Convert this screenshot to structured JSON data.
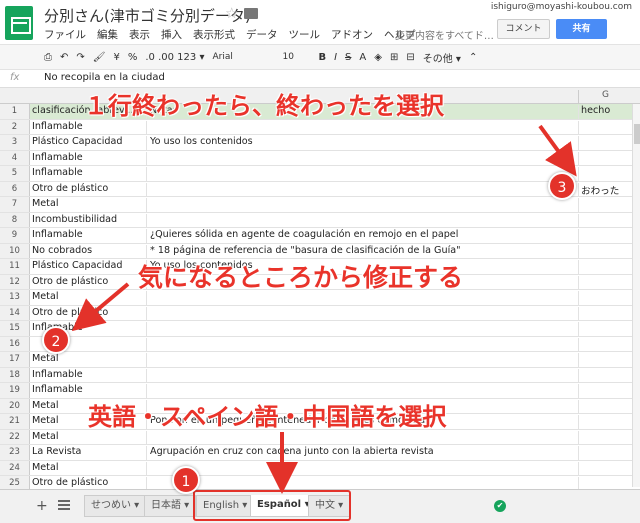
{
  "app": {
    "doc_title": "分別さん(津市ゴミ分別データ)",
    "menus": [
      "ファイル",
      "編集",
      "表示",
      "挿入",
      "表示形式",
      "データ",
      "ツール",
      "アドオン",
      "ヘルプ"
    ],
    "save_status": "変更内容をすべてド…",
    "user_email": "ishiguro@moyashi-koubou.com",
    "comment_label": "コメント",
    "share_label": "共有"
  },
  "toolbar": {
    "currency": "¥",
    "percent": "%",
    "decimals": ".0  .00  123 ▾",
    "font": "Arial",
    "font_size": "10",
    "bold": "B",
    "italic": "I",
    "strike": "S",
    "more": "その他 ▾"
  },
  "formula": {
    "fx": "fx",
    "value": "No recopila en la ciudad"
  },
  "columns": {
    "g": "G"
  },
  "rows": [
    {
      "n": "1",
      "a": "clasificación (abrevi...",
      "b": "Notas",
      "g": "hecho"
    },
    {
      "n": "2",
      "a": "Inflamable",
      "b": "",
      "g": ""
    },
    {
      "n": "3",
      "a": "Plástico Capacidad",
      "b": "Yo uso los contenidos",
      "g": ""
    },
    {
      "n": "4",
      "a": "Inflamable",
      "b": "",
      "g": ""
    },
    {
      "n": "5",
      "a": "Inflamable",
      "b": "",
      "g": ""
    },
    {
      "n": "6",
      "a": "Otro de plástico",
      "b": "",
      "g": "おわった"
    },
    {
      "n": "7",
      "a": "Metal",
      "b": "",
      "g": ""
    },
    {
      "n": "8",
      "a": "Incombustibilidad",
      "b": "",
      "g": ""
    },
    {
      "n": "9",
      "a": "Inflamable",
      "b": "¿Quieres sólida en agente de coagulación en remojo en el papel",
      "g": ""
    },
    {
      "n": "10",
      "a": "No cobrados",
      "b": "* 18 página de referencia de \"basura de clasificación de la Guía\"",
      "g": ""
    },
    {
      "n": "11",
      "a": "Plástico Capacidad",
      "b": "Yo uso los contenidos",
      "g": ""
    },
    {
      "n": "12",
      "a": "Otro de plástico",
      "b": "",
      "g": ""
    },
    {
      "n": "13",
      "a": "Metal",
      "b": "",
      "g": ""
    },
    {
      "n": "14",
      "a": "Otro de plástico",
      "b": "",
      "g": ""
    },
    {
      "n": "15",
      "a": "Inflamable",
      "b": "",
      "g": ""
    },
    {
      "n": "16",
      "a": "",
      "b": "",
      "g": ""
    },
    {
      "n": "17",
      "a": "Metal",
      "b": "",
      "g": ""
    },
    {
      "n": "18",
      "a": "Inflamable",
      "b": "",
      "g": ""
    },
    {
      "n": "19",
      "a": "Inflamable",
      "b": "",
      "g": ""
    },
    {
      "n": "20",
      "a": "Metal",
      "b": "",
      "g": ""
    },
    {
      "n": "21",
      "a": "Metal",
      "b": "Pon Pon en un pequeño contenedor de ... tales como latas",
      "g": ""
    },
    {
      "n": "22",
      "a": "Metal",
      "b": "",
      "g": ""
    },
    {
      "n": "23",
      "a": "La Revista",
      "b": "Agrupación en cruz con cadena junto con la abierta revista",
      "g": ""
    },
    {
      "n": "24",
      "a": "Metal",
      "b": "",
      "g": ""
    },
    {
      "n": "25",
      "a": "Otro de plástico",
      "b": "",
      "g": ""
    }
  ],
  "sheets": [
    {
      "label": "せつめい ▾"
    },
    {
      "label": "日本語 ▾"
    },
    {
      "label": "English ▾"
    },
    {
      "label": "Español ▾"
    },
    {
      "label": "中文 ▾"
    }
  ],
  "annotations": {
    "top": "１行終わったら、終わったを選択",
    "middle": "気になるところから修正する",
    "bottom": "英語・スペイン語・中国語を選択",
    "n1": "1",
    "n2": "2",
    "n3": "3",
    "color": "#e3322a"
  }
}
